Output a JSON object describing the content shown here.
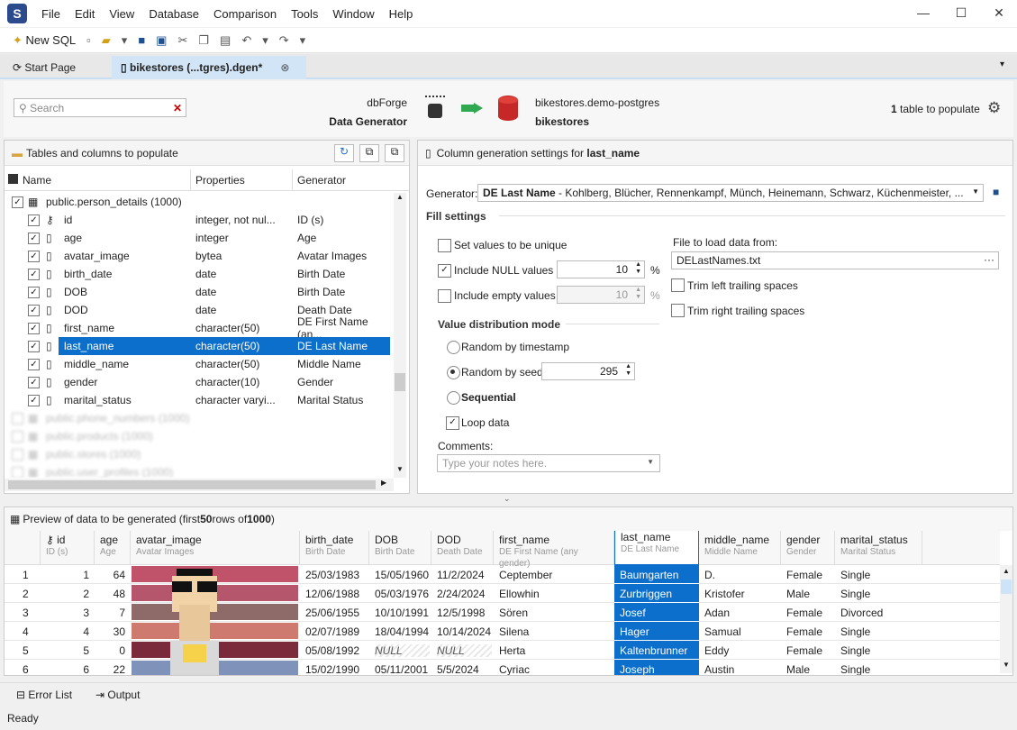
{
  "menu": [
    "File",
    "Edit",
    "View",
    "Database",
    "Comparison",
    "Tools",
    "Window",
    "Help"
  ],
  "toolbar": {
    "new_sql": "New SQL"
  },
  "tabs": [
    {
      "label": "Start Page"
    },
    {
      "label": "bikestores (...tgres).dgen*"
    }
  ],
  "header": {
    "search_placeholder": "Search",
    "product_line1": "dbForge",
    "product_line2": "Data Generator",
    "target_line1": "bikestores.demo-postgres",
    "target_line2": "bikestores",
    "populate_count": "1",
    "populate_text": "table to populate"
  },
  "tree": {
    "title": "Tables and columns to populate",
    "cols": [
      "Name",
      "Properties",
      "Generator"
    ],
    "table": "public.person_details (1000)",
    "rows": [
      {
        "name": "id",
        "prop": "integer, not nul...",
        "gen": "ID (s)"
      },
      {
        "name": "age",
        "prop": "integer",
        "gen": "Age"
      },
      {
        "name": "avatar_image",
        "prop": "bytea",
        "gen": "Avatar Images"
      },
      {
        "name": "birth_date",
        "prop": "date",
        "gen": "Birth Date"
      },
      {
        "name": "DOB",
        "prop": "date",
        "gen": "Birth Date"
      },
      {
        "name": "DOD",
        "prop": "date",
        "gen": "Death Date"
      },
      {
        "name": "first_name",
        "prop": "character(50)",
        "gen": "DE First Name (an..."
      },
      {
        "name": "last_name",
        "prop": "character(50)",
        "gen": "DE Last Name"
      },
      {
        "name": "middle_name",
        "prop": "character(50)",
        "gen": "Middle Name"
      },
      {
        "name": "gender",
        "prop": "character(10)",
        "gen": "Gender"
      },
      {
        "name": "marital_status",
        "prop": "character varyi...",
        "gen": "Marital Status"
      }
    ],
    "blurred": [
      "public.phone_numbers (1000)",
      "public.products (1000)",
      "public.stores (1000)",
      "public.user_profiles (1000)"
    ]
  },
  "settings": {
    "title_prefix": "Column generation settings for ",
    "column": "last_name",
    "generator_label": "Generator:",
    "generator_name": "DE Last Name",
    "generator_desc": " - Kohlberg, Blücher, Rennenkampf, Münch, Heinemann, Schwarz, Küchenmeister, ...",
    "fill_settings": "Fill settings",
    "set_unique": "Set values to be unique",
    "include_null": "Include NULL values",
    "null_value": "10",
    "include_empty": "Include empty values",
    "empty_value": "10",
    "pct": "%",
    "file_label": "File to load data from:",
    "file_value": "DELastNames.txt",
    "trim_left": "Trim left trailing spaces",
    "trim_right": "Trim right trailing spaces",
    "dist_title": "Value distribution mode",
    "random_ts": "Random by timestamp",
    "random_seed": "Random by seed",
    "seed_value": "295",
    "sequential": "Sequential",
    "loop": "Loop data",
    "comments_label": "Comments:",
    "comments_placeholder": "Type your notes here."
  },
  "preview": {
    "title_pre": "Preview of data to be generated (first ",
    "rows": "50",
    "title_mid": " rows of ",
    "total": "1000",
    "title_post": ")",
    "cols": [
      {
        "name": "id",
        "sub": "ID (s)"
      },
      {
        "name": "age",
        "sub": "Age"
      },
      {
        "name": "avatar_image",
        "sub": "Avatar Images"
      },
      {
        "name": "birth_date",
        "sub": "Birth Date"
      },
      {
        "name": "DOB",
        "sub": "Birth Date"
      },
      {
        "name": "DOD",
        "sub": "Death Date"
      },
      {
        "name": "first_name",
        "sub": "DE First Name (any gender)"
      },
      {
        "name": "last_name",
        "sub": "DE Last Name"
      },
      {
        "name": "middle_name",
        "sub": "Middle Name"
      },
      {
        "name": "gender",
        "sub": "Gender"
      },
      {
        "name": "marital_status",
        "sub": "Marital Status"
      }
    ],
    "data": [
      [
        "1",
        "1",
        "64",
        "25/03/1983",
        "15/05/1960",
        "11/2/2024",
        "Ceptember",
        "Baumgarten",
        "D.",
        "Female",
        "Single"
      ],
      [
        "2",
        "2",
        "48",
        "12/06/1988",
        "05/03/1976",
        "2/24/2024",
        "Ellowhin",
        "Zurbriggen",
        "Kristofer",
        "Male",
        "Single"
      ],
      [
        "3",
        "3",
        "7",
        "25/06/1955",
        "10/10/1991",
        "12/5/1998",
        "Sören",
        "Josef",
        "Adan",
        "Female",
        "Divorced"
      ],
      [
        "4",
        "4",
        "30",
        "02/07/1989",
        "18/04/1994",
        "10/14/2024",
        "Silena",
        "Hager",
        "Samual",
        "Female",
        "Single"
      ],
      [
        "5",
        "5",
        "0",
        "05/08/1992",
        "NULL",
        "NULL",
        "Herta",
        "Kaltenbrunner",
        "Eddy",
        "Female",
        "Single"
      ],
      [
        "6",
        "6",
        "22",
        "15/02/1990",
        "05/11/2001",
        "5/5/2024",
        "Cyriac",
        "Joseph",
        "Austin",
        "Male",
        "Single"
      ]
    ],
    "avatar_colors": [
      "#c0526a",
      "#b5566c",
      "#8e6a68",
      "#cf7a6e",
      "#7a2a3a",
      "#7f93ba"
    ]
  },
  "bottom": {
    "error_list": "Error List",
    "output": "Output",
    "status": "Ready"
  }
}
